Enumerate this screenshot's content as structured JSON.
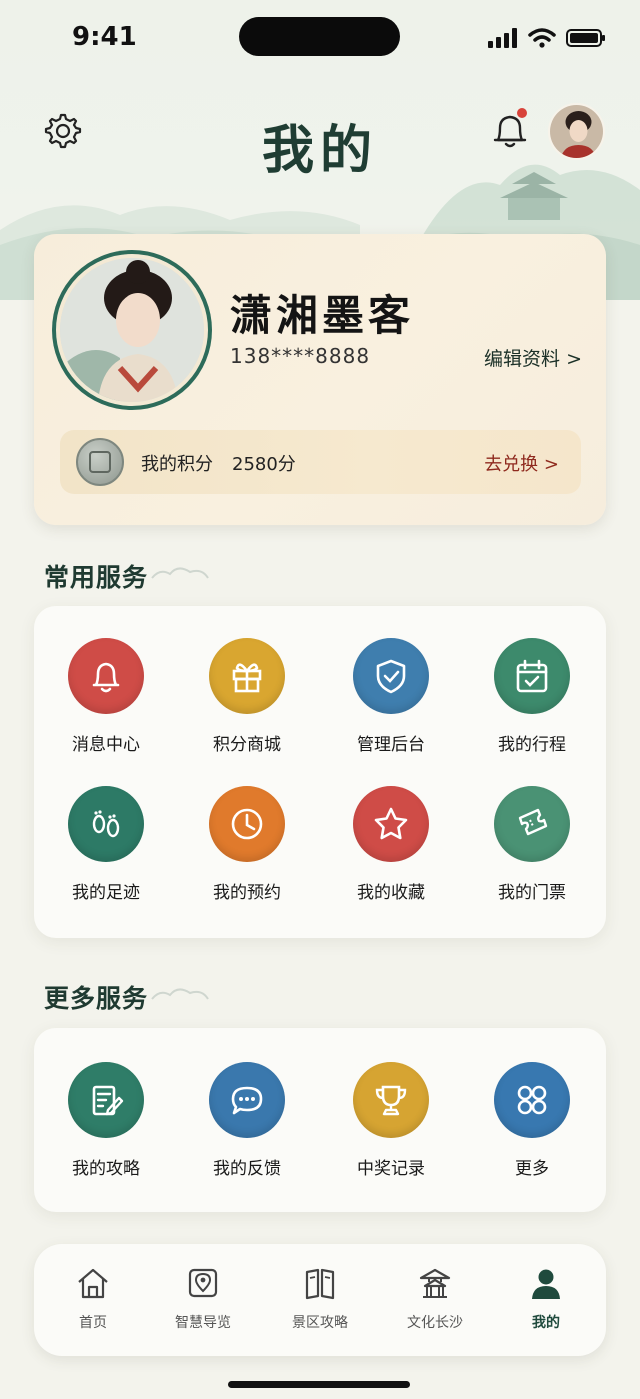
{
  "status_bar": {
    "time": "9:41"
  },
  "header": {
    "title": "我的"
  },
  "profile": {
    "nickname": "潇湘墨客",
    "phone": "138****8888",
    "edit_label": "编辑资料 >"
  },
  "points": {
    "label": "我的积分",
    "value": "2580分",
    "exchange_label": "去兑换 >"
  },
  "common_services": {
    "title": "常用服务",
    "items": [
      {
        "label": "消息中心",
        "icon": "bell-icon",
        "color": "#cf4c47"
      },
      {
        "label": "积分商城",
        "icon": "gift-icon",
        "color": "#d9a630"
      },
      {
        "label": "管理后台",
        "icon": "shield-check-icon",
        "color": "#3f7eae"
      },
      {
        "label": "我的行程",
        "icon": "calendar-check-icon",
        "color": "#3d8a6c"
      },
      {
        "label": "我的足迹",
        "icon": "footprints-icon",
        "color": "#2d7a66"
      },
      {
        "label": "我的预约",
        "icon": "clock-icon",
        "color": "#e07a2c"
      },
      {
        "label": "我的收藏",
        "icon": "star-icon",
        "color": "#cf4c47"
      },
      {
        "label": "我的门票",
        "icon": "ticket-icon",
        "color": "#4a9274"
      }
    ]
  },
  "more_services": {
    "title": "更多服务",
    "items": [
      {
        "label": "我的攻略",
        "icon": "note-edit-icon",
        "color": "#2f7d68"
      },
      {
        "label": "我的反馈",
        "icon": "chat-bubble-icon",
        "color": "#3a78ad"
      },
      {
        "label": "中奖记录",
        "icon": "trophy-icon",
        "color": "#d6a432"
      },
      {
        "label": "更多",
        "icon": "grid-icon",
        "color": "#3878b0"
      }
    ]
  },
  "tabbar": {
    "items": [
      {
        "label": "首页",
        "icon": "home-icon",
        "active": false
      },
      {
        "label": "智慧导览",
        "icon": "map-pin-icon",
        "active": false
      },
      {
        "label": "景区攻略",
        "icon": "book-icon",
        "active": false
      },
      {
        "label": "文化长沙",
        "icon": "pavilion-icon",
        "active": false
      },
      {
        "label": "我的",
        "icon": "user-icon",
        "active": true
      }
    ]
  },
  "colors": {
    "brand_green": "#1f4a3d",
    "accent_red": "#8f2a1e",
    "background": "#f3f3ec"
  }
}
